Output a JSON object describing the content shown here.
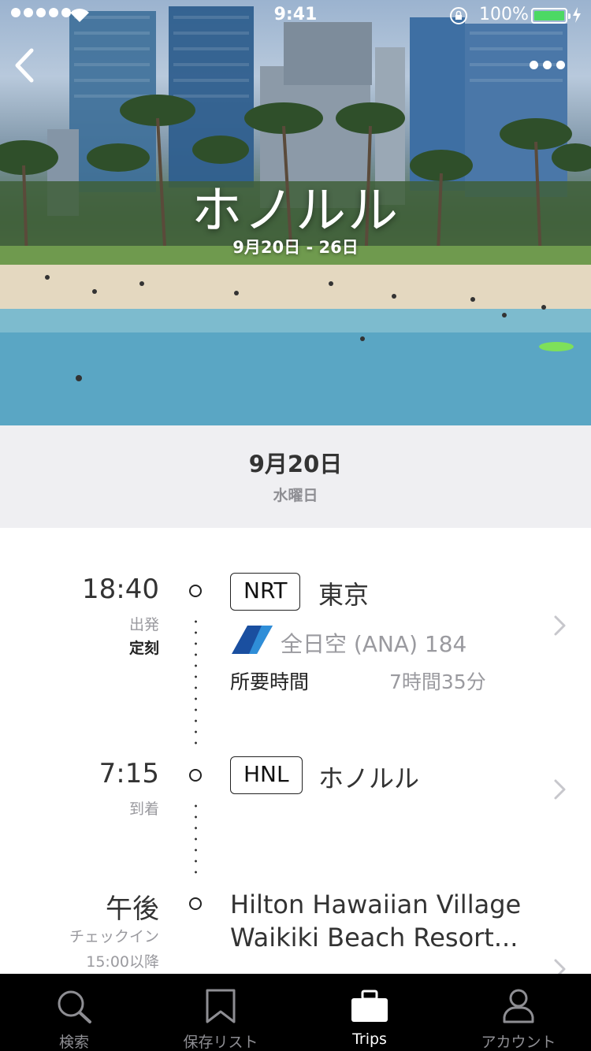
{
  "status_bar": {
    "time": "9:41",
    "battery": "100%"
  },
  "hero": {
    "title": "ホノルル",
    "dates": "9月20日 - 26日",
    "back_icon": "chevron-left-icon",
    "more_icon": "ellipsis-icon"
  },
  "day": {
    "date": "9月20日",
    "weekday": "水曜日"
  },
  "timeline": {
    "departure": {
      "time": "18:40",
      "label": "出発",
      "status": "定刻",
      "code": "NRT",
      "city": "東京",
      "airline": "全日空 (ANA) 184",
      "duration_label": "所要時間",
      "duration_value": "7時間35分"
    },
    "arrival": {
      "time": "7:15",
      "label": "到着",
      "code": "HNL",
      "city": "ホノルル"
    },
    "hotel": {
      "time": "午後",
      "label": "チェックイン",
      "detail": "15:00以降",
      "name_line1": "Hilton Hawaiian Village",
      "name_line2": "Waikiki Beach Resort..."
    }
  },
  "tabbar": {
    "tabs": [
      {
        "label": "検索",
        "icon": "search-icon",
        "active": false
      },
      {
        "label": "保存リスト",
        "icon": "bookmark-icon",
        "active": false
      },
      {
        "label": "Trips",
        "icon": "suitcase-icon",
        "active": true
      },
      {
        "label": "アカウント",
        "icon": "person-icon",
        "active": false
      }
    ]
  },
  "colors": {
    "accent_active": "#ffffff",
    "tab_inactive": "#8e8e93",
    "battery_green": "#4cd964",
    "ana_blue": "#1a4fa0"
  }
}
